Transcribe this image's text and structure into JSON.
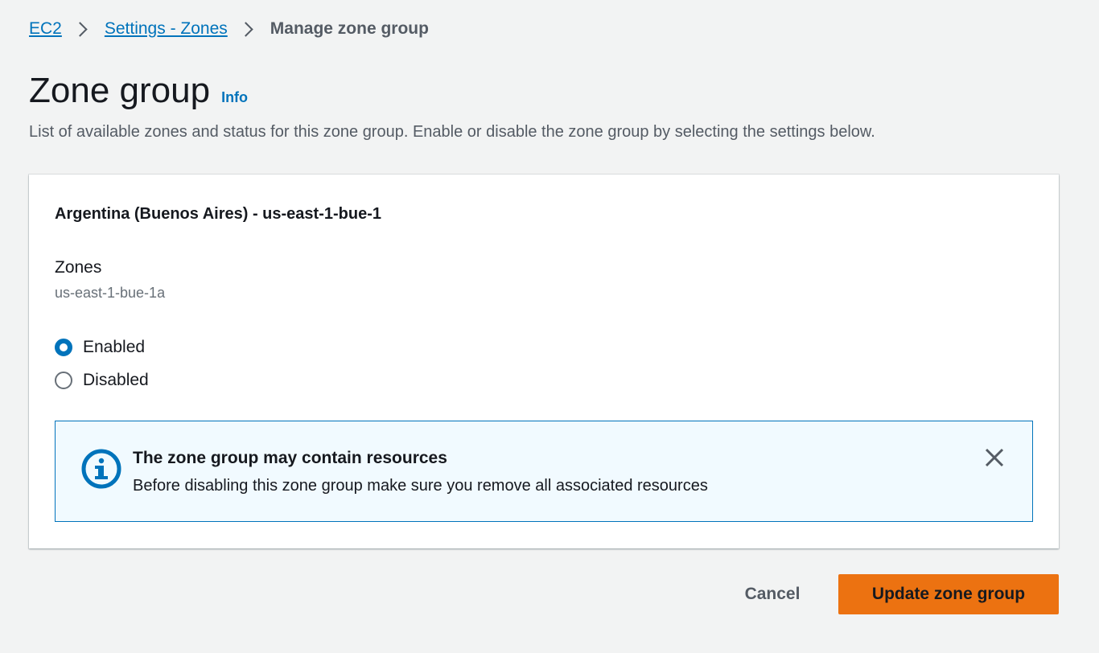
{
  "breadcrumb": {
    "items": [
      "EC2",
      "Settings - Zones"
    ],
    "current": "Manage zone group"
  },
  "header": {
    "title": "Zone group",
    "info_label": "Info",
    "description": "List of available zones and status for this zone group. Enable or disable the zone group by selecting the settings below."
  },
  "card": {
    "title": "Argentina (Buenos Aires) - us-east-1-bue-1",
    "zones_label": "Zones",
    "zones_value": "us-east-1-bue-1a",
    "options": [
      {
        "label": "Enabled",
        "checked": true
      },
      {
        "label": "Disabled",
        "checked": false
      }
    ],
    "alert": {
      "icon": "info-circle-icon",
      "title": "The zone group may contain resources",
      "text": "Before disabling this zone group make sure you remove all associated resources"
    }
  },
  "actions": {
    "cancel_label": "Cancel",
    "submit_label": "Update zone group"
  },
  "colors": {
    "link": "#0073bb",
    "primary": "#ec7211",
    "info": "#0073bb",
    "background": "#f2f3f3"
  }
}
